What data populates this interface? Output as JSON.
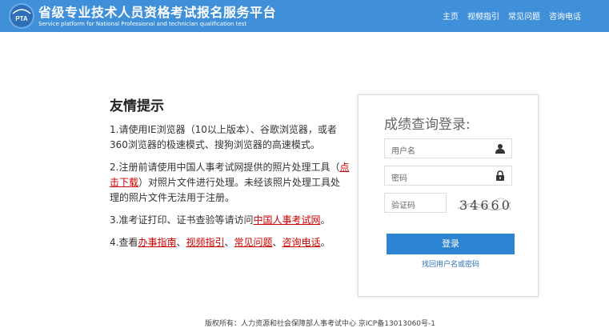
{
  "header": {
    "title": "省级专业技术人员资格考试报名服务平台",
    "subtitle": "Service platform for National Professional and technician qualification test",
    "logo_text": "PTA",
    "nav": [
      "主页",
      "视频指引",
      "常见问题",
      "咨询电话"
    ]
  },
  "tips": {
    "title": "友情提示",
    "tip1": "1.请使用IE浏览器（10以上版本）、谷歌浏览器，或者360浏览器的极速模式、搜狗浏览器的高速模式。",
    "tip2_pre": "2.注册前请使用中国人事考试网提供的照片处理工具（",
    "tip2_link": "点击下载",
    "tip2_post": "）对照片文件进行处理。未经该照片处理工具处理的照片文件无法用于注册。",
    "tip3_pre": "3.准考证打印、证书查验等请访问",
    "tip3_link": "中国人事考试网",
    "tip3_post": "。",
    "tip4_pre": "4.查看",
    "tip4_links": [
      "办事指南",
      "视频指引",
      "常见问题",
      "咨询电话"
    ],
    "tip4_sep": "、",
    "tip4_post": "。"
  },
  "login": {
    "title": "成绩查询登录:",
    "username_placeholder": "用户名",
    "password_placeholder": "密码",
    "captcha_placeholder": "验证码",
    "captcha_code": "34660",
    "button_label": "登录",
    "forgot_link": "找回用户名或密码"
  },
  "footer": {
    "text": "版权所有：人力资源和社会保障部人事考试中心 京ICP备13013060号-1"
  },
  "colors": {
    "header_bg": "#3f8fd9",
    "button_bg": "#2d84d2",
    "link_red": "#cc0000"
  }
}
